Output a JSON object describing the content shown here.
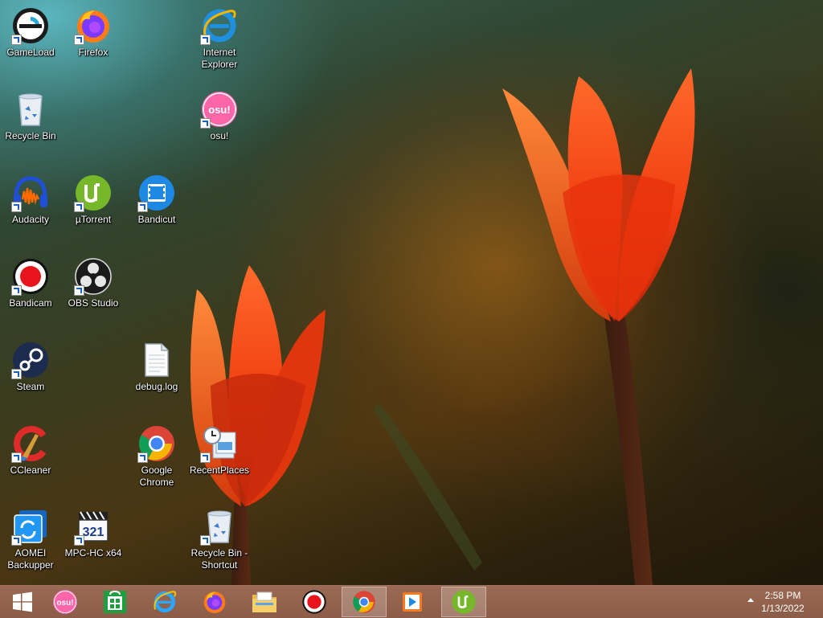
{
  "desktop": {
    "icons": {
      "gameload": "GameLoad",
      "firefox": "Firefox",
      "ie": "Internet Explorer",
      "recycle": "Recycle Bin",
      "osu": "osu!",
      "audacity": "Audacity",
      "utorrent": "µTorrent",
      "bandicut": "Bandicut",
      "bandicam": "Bandicam",
      "obs": "OBS Studio",
      "steam": "Steam",
      "debuglog": "debug.log",
      "ccleaner": "CCleaner",
      "chrome": "Google Chrome",
      "recentplaces": "RecentPlaces",
      "aomei": "AOMEI Backupper",
      "mpchc": "MPC-HC x64",
      "recycle_shortcut": "Recycle Bin - Shortcut"
    }
  },
  "taskbar": {
    "osu_glyph": "osu!",
    "mpc_digits": "321",
    "clock": {
      "time": "2:58 PM",
      "date": "1/13/2022"
    },
    "buttons": [
      {
        "icon": "windows-start-icon"
      },
      {
        "icon": "osu-icon"
      },
      {
        "icon": "store-icon"
      },
      {
        "icon": "internet-explorer-icon"
      },
      {
        "icon": "firefox-icon"
      },
      {
        "icon": "file-explorer-icon"
      },
      {
        "icon": "bandicam-icon"
      },
      {
        "icon": "chrome-icon"
      },
      {
        "icon": "media-player-icon"
      },
      {
        "icon": "utorrent-icon"
      }
    ]
  },
  "colors": {
    "taskbar": "#8b5c47",
    "icon_label": "#ffffff",
    "shortcut_arrow": "#1b5fc1"
  }
}
